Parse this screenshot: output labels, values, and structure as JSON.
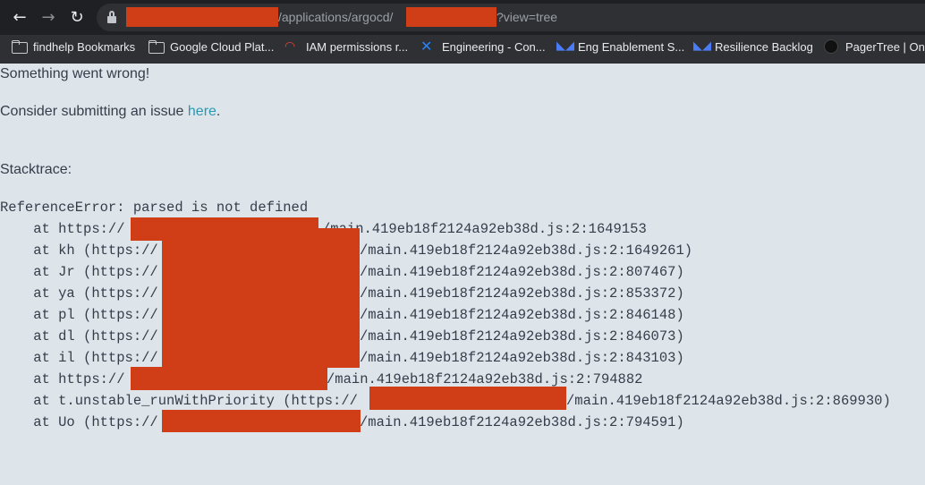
{
  "browser": {
    "url_visible_mid": "/applications/argocd/",
    "url_visible_end": "?view=tree",
    "back_glyph": "←",
    "forward_glyph": "→",
    "reload_glyph": "↻"
  },
  "bookmarks": [
    {
      "label": "findhelp Bookmarks",
      "icon": "folder-icon"
    },
    {
      "label": "Google Cloud Plat...",
      "icon": "google-cloud-icon"
    },
    {
      "label": "IAM permissions r...",
      "icon": "google-cloud-icon"
    },
    {
      "label": "Engineering - Con...",
      "icon": "confluence-icon"
    },
    {
      "label": "Eng Enablement S...",
      "icon": "jira-icon"
    },
    {
      "label": "Resilience Backlog",
      "icon": "jira-icon"
    },
    {
      "label": "PagerTree | On-C",
      "icon": "pagertree-icon"
    }
  ],
  "page": {
    "error_title": "Something went wrong!",
    "issue_prefix": "Consider submitting an issue ",
    "issue_link": "here",
    "issue_suffix": ".",
    "stack_label": "Stacktrace:",
    "trace_header": "ReferenceError: parsed is not defined",
    "trace_lines": [
      {
        "pre": "    at https://",
        "post": "/main.419eb18f2124a92eb38d.js:2:1649153"
      },
      {
        "pre": "    at kh (https://",
        "post": "/main.419eb18f2124a92eb38d.js:2:1649261)"
      },
      {
        "pre": "    at Jr (https://",
        "post": "/main.419eb18f2124a92eb38d.js:2:807467)"
      },
      {
        "pre": "    at ya (https://",
        "post": "/main.419eb18f2124a92eb38d.js:2:853372)"
      },
      {
        "pre": "    at pl (https://",
        "post": "/main.419eb18f2124a92eb38d.js:2:846148)"
      },
      {
        "pre": "    at dl (https://",
        "post": "/main.419eb18f2124a92eb38d.js:2:846073)"
      },
      {
        "pre": "    at il (https://",
        "post": "/main.419eb18f2124a92eb38d.js:2:843103)"
      },
      {
        "pre": "    at https://",
        "post": "/main.419eb18f2124a92eb38d.js:2:794882"
      },
      {
        "pre": "    at t.unstable_runWithPriority (https://",
        "post": "/main.419eb18f2124a92eb38d.js:2:869930)"
      },
      {
        "pre": "    at Uo (https://",
        "post": "/main.419eb18f2124a92eb38d.js:2:794591)"
      }
    ]
  },
  "colors": {
    "page_bg": "#dee5ea",
    "text": "#363c4a",
    "link": "#2a98b0",
    "redaction": "#d03e17",
    "chrome_dark": "#1f2023"
  }
}
